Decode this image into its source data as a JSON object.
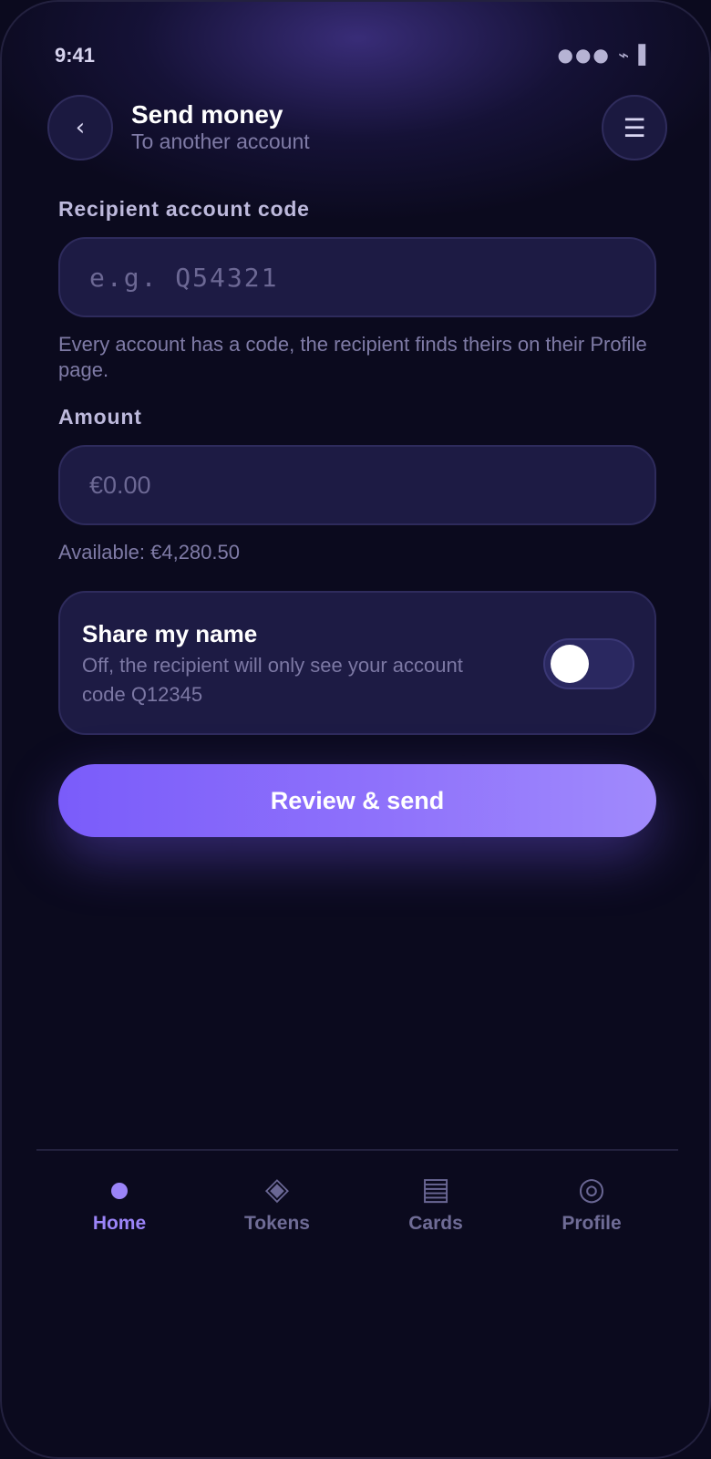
{
  "status_bar": {
    "time": "9:41",
    "icons": "●●● ⌁ ▌"
  },
  "header": {
    "back_icon": "‹",
    "menu_icon": "☰",
    "title": "Send money",
    "subtitle": "To another account"
  },
  "recipient": {
    "label": "Recipient account code",
    "placeholder": "e.g. Q54321",
    "helper": "Every account has a code, the recipient finds theirs on their Profile page."
  },
  "amount": {
    "label": "Amount",
    "placeholder": "€0.00",
    "available": "Available: €4,280.50"
  },
  "share_name": {
    "title": "Share my name",
    "description": "Off, the recipient will only see your account code Q12345",
    "enabled": false
  },
  "primary_action": {
    "label": "Review & send",
    "colors": [
      "#7a5cfa",
      "#a08afc"
    ]
  },
  "bottom_nav": {
    "items": [
      {
        "label": "Home",
        "icon": "home-dot-icon",
        "active": true
      },
      {
        "label": "Tokens",
        "icon": "◈",
        "active": false
      },
      {
        "label": "Cards",
        "icon": "▤",
        "active": false
      },
      {
        "label": "Profile",
        "icon": "◎",
        "active": false
      }
    ]
  },
  "colors": {
    "background": "#0b0a1e",
    "accent": "#9b84f8",
    "card": "#1d1b44"
  }
}
